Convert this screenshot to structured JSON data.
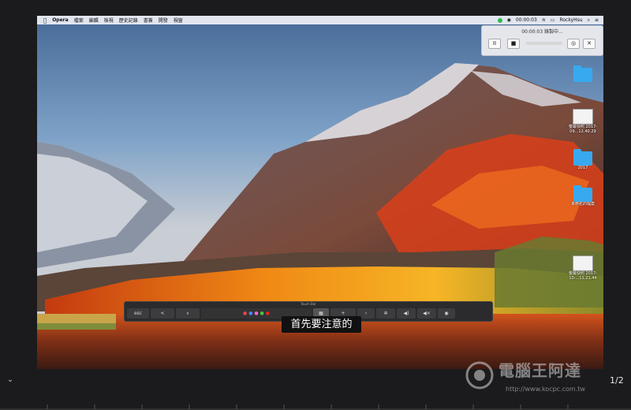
{
  "menubar": {
    "app_name": "Opera",
    "items": [
      "檔案",
      "編輯",
      "檢視",
      "歷史記錄",
      "書簽",
      "開發",
      "視窗"
    ],
    "status_time": "00:00:03",
    "user": "RockyHsu"
  },
  "recorder": {
    "title": "00:00:03 錄製中...",
    "pause": "II",
    "stop": "■",
    "close": "✕"
  },
  "desktop_icons": [
    {
      "kind": "folder",
      "label": ""
    },
    {
      "kind": "screenshot",
      "label": "螢幕快照 2017-09...12.40.29"
    },
    {
      "kind": "folder",
      "label": "2017"
    },
    {
      "kind": "folder",
      "label": "未命名的檔案"
    },
    {
      "kind": "screenshot",
      "label": "螢幕快照 2017-10-...11.21.44"
    }
  ],
  "touchbar": {
    "header": "Touch Bar",
    "esc": "esc",
    "back": "<",
    "search": "⌕",
    "add": "+"
  },
  "caption": "首先要注意的",
  "page_indicator": "1/2",
  "watermark": {
    "text": "電腦王阿達",
    "url": "http://www.kocpc.com.tw"
  },
  "colors": {
    "background": "#1b1b1d",
    "menubar": "#eef0f5",
    "folder": "#38a9ef"
  }
}
